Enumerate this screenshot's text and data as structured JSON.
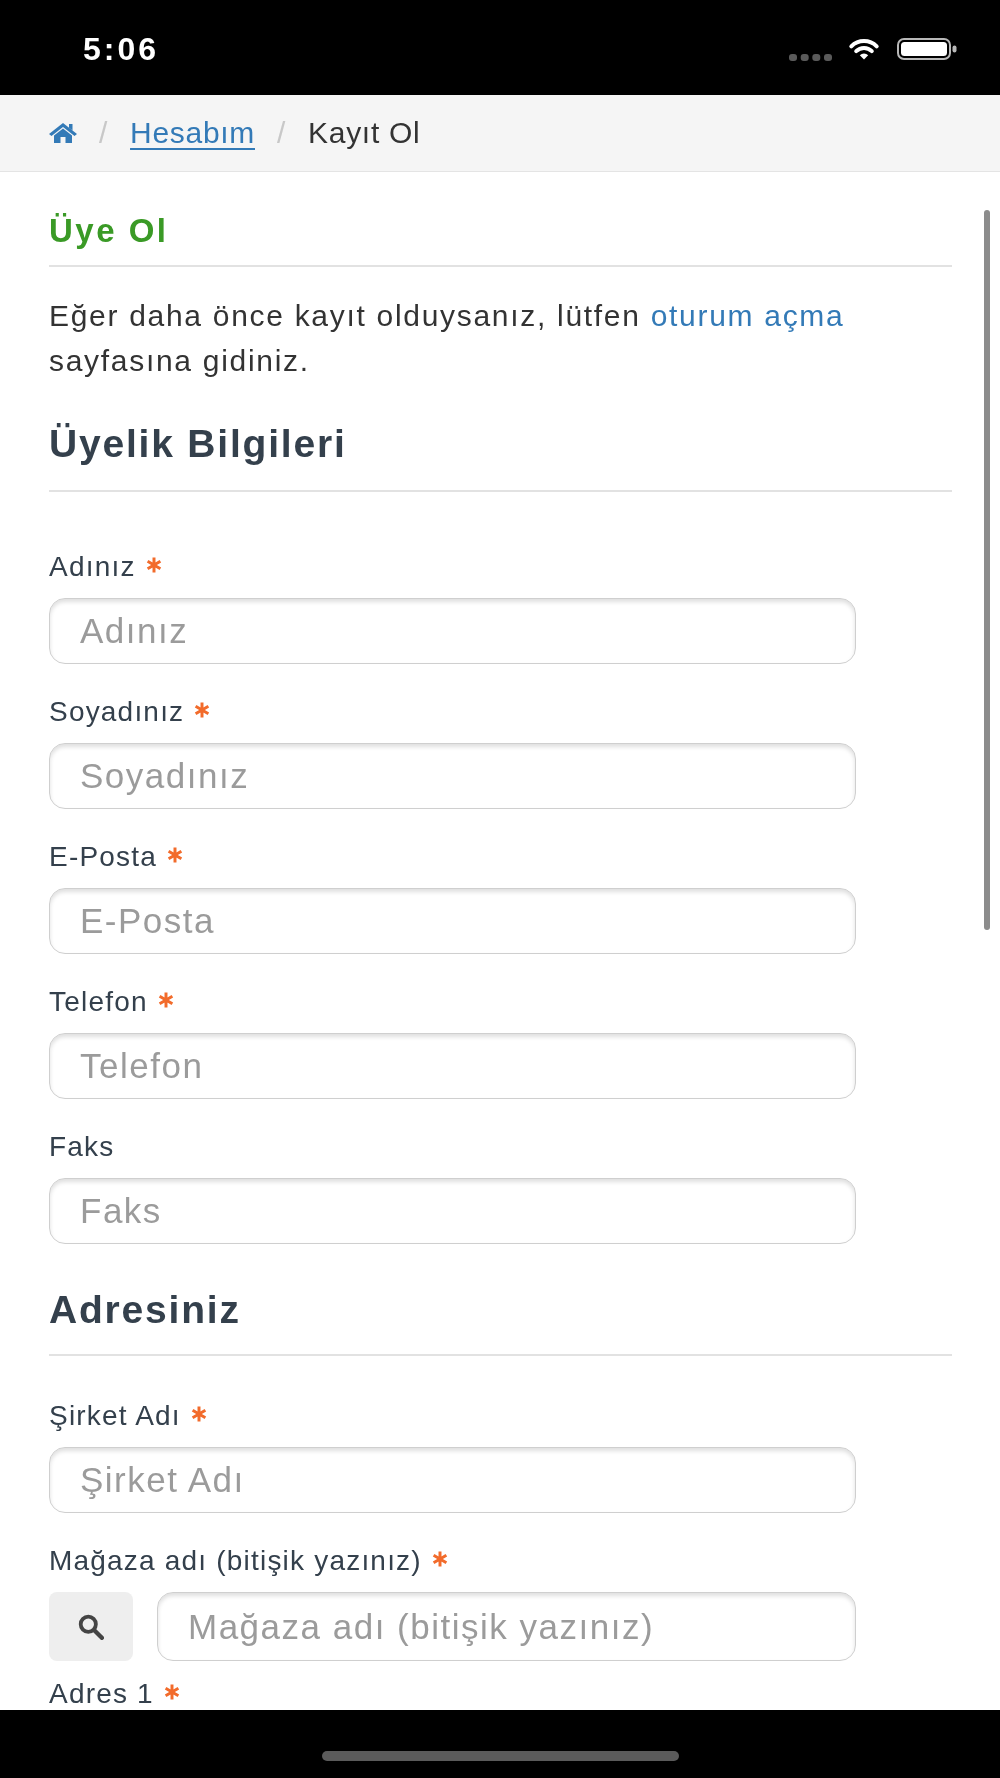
{
  "status_bar": {
    "time": "5:06"
  },
  "breadcrumb": [
    {
      "kind": "home"
    },
    {
      "kind": "link",
      "separator": "/",
      "label": "Hesabım"
    },
    {
      "kind": "current",
      "separator": "/",
      "label": "Kayıt Ol"
    }
  ],
  "page_title": "Üye Ol",
  "intro": {
    "before": "Eğer daha önce kayıt olduysanız, lütfen ",
    "link": "oturum açma",
    "after": " sayfasına gidiniz."
  },
  "sections": [
    {
      "heading": "Üyelik Bilgileri",
      "fields": [
        {
          "kind": "text",
          "label": "Adınız",
          "required": true,
          "placeholder": "Adınız"
        },
        {
          "kind": "text",
          "label": "Soyadınız",
          "required": true,
          "placeholder": "Soyadınız"
        },
        {
          "kind": "text",
          "label": "E-Posta",
          "required": true,
          "placeholder": "E-Posta"
        },
        {
          "kind": "text",
          "label": "Telefon",
          "required": true,
          "placeholder": "Telefon"
        },
        {
          "kind": "text",
          "label": "Faks",
          "required": false,
          "placeholder": "Faks"
        }
      ]
    },
    {
      "heading": "Adresiniz",
      "fields": [
        {
          "kind": "text",
          "label": "Şirket Adı",
          "required": true,
          "placeholder": "Şirket Adı"
        },
        {
          "kind": "search",
          "label": "Mağaza adı (bitişik yazınız)",
          "required": true,
          "placeholder": "Mağaza adı (bitişik yazınız)"
        },
        {
          "kind": "label_only",
          "label": "Adres 1",
          "required": true
        }
      ]
    }
  ]
}
